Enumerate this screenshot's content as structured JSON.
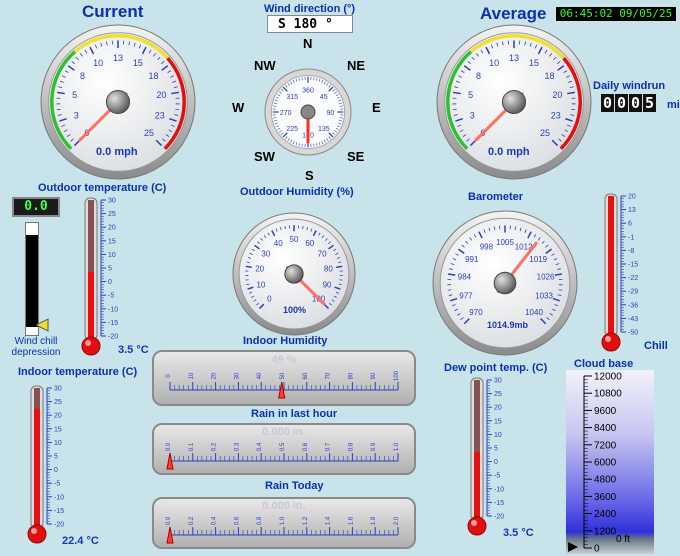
{
  "header": {
    "current_label": "Current",
    "wind_direction_label": "Wind direction (°)",
    "wind_direction_value": "S  180 °",
    "average_label": "Average",
    "clock": "06:45:02 09/05/25"
  },
  "wind_speed_current": {
    "value_text": "0.0 mph",
    "ticks": [
      "0",
      "3",
      "5",
      "8",
      "10",
      "13",
      "15",
      "18",
      "20",
      "23",
      "25"
    ],
    "value": 0
  },
  "wind_speed_average": {
    "value_text": "0.0 mph",
    "ticks": [
      "0",
      "3",
      "5",
      "8",
      "10",
      "13",
      "15",
      "18",
      "20",
      "23",
      "25"
    ],
    "value": 0
  },
  "compass": {
    "labels": {
      "n": "N",
      "ne": "NE",
      "e": "E",
      "se": "SE",
      "s": "S",
      "sw": "SW",
      "w": "W",
      "nw": "NW"
    },
    "ticks": [
      "360",
      "45",
      "90",
      "135",
      "180",
      "225",
      "270",
      "315"
    ],
    "direction_deg": 180
  },
  "daily_windrun": {
    "label": "Daily windrun",
    "digits": [
      "0",
      "0",
      "0",
      "5"
    ],
    "unit": "mi"
  },
  "outdoor_temp": {
    "label": "Outdoor temperature (C)",
    "value_text": "3.5 °C",
    "lcd": "0.0",
    "scale": [
      "30",
      "25",
      "20",
      "15",
      "10",
      "5",
      "0",
      "-5",
      "-10",
      "-15",
      "-20"
    ],
    "value": 3.5,
    "wind_chill_label": "Wind chill depression"
  },
  "outdoor_humidity": {
    "label": "Outdoor Humidity (%)",
    "value_text": "100%",
    "ticks": [
      "0",
      "10",
      "20",
      "30",
      "40",
      "50",
      "60",
      "70",
      "80",
      "90",
      "100"
    ],
    "value": 100
  },
  "barometer": {
    "label": "Barometer",
    "value_text": "1014.9mb",
    "ticks": [
      "970",
      "977",
      "984",
      "991",
      "998",
      "1005",
      "1012",
      "1019",
      "1026",
      "1033",
      "1040"
    ],
    "value": 1014.9
  },
  "chill": {
    "label": "Chill",
    "scale": [
      "20",
      "13",
      "6",
      "-1",
      "-8",
      "-15",
      "-22",
      "-29",
      "-36",
      "-43",
      "-50"
    ]
  },
  "indoor_humidity": {
    "label": "Indoor Humidity",
    "value_text": "49 %",
    "ticks": [
      "0",
      "10",
      "20",
      "30",
      "40",
      "50",
      "60",
      "70",
      "80",
      "90",
      "100"
    ],
    "value": 49
  },
  "rain_last_hour": {
    "label": "Rain in last hour",
    "value_text": "0.000 in.",
    "ticks": [
      "0.0",
      "0.1",
      "0.2",
      "0.3",
      "0.4",
      "0.5",
      "0.6",
      "0.7",
      "0.8",
      "0.9",
      "1.0"
    ]
  },
  "rain_today": {
    "label": "Rain Today",
    "value_text": "0.000 in.",
    "ticks": [
      "0.0",
      "0.2",
      "0.4",
      "0.6",
      "0.8",
      "1.0",
      "1.2",
      "1.4",
      "1.6",
      "1.8",
      "2.0"
    ]
  },
  "indoor_temp": {
    "label": "Indoor temperature (C)",
    "value_text": "22.4 °C",
    "scale": [
      "30",
      "25",
      "20",
      "15",
      "10",
      "5",
      "0",
      "-5",
      "-10",
      "-15",
      "-20"
    ],
    "value": 22.4
  },
  "dew_point": {
    "label": "Dew point temp. (C)",
    "value_text": "3.5 °C",
    "scale": [
      "30",
      "25",
      "20",
      "15",
      "10",
      "5",
      "0",
      "-5",
      "-10",
      "-15",
      "-20"
    ],
    "value": 3.5
  },
  "cloud_base": {
    "label": "Cloud base",
    "scale": [
      "12000",
      "10800",
      "9600",
      "8400",
      "7200",
      "6000",
      "4800",
      "3600",
      "2400",
      "1200",
      "0"
    ],
    "value_text": "0 ft"
  },
  "colors": {
    "background": "#c8e4ea",
    "title": "#0a2fb5",
    "needle": "#ff6a5a",
    "mercury": "#e01010"
  }
}
